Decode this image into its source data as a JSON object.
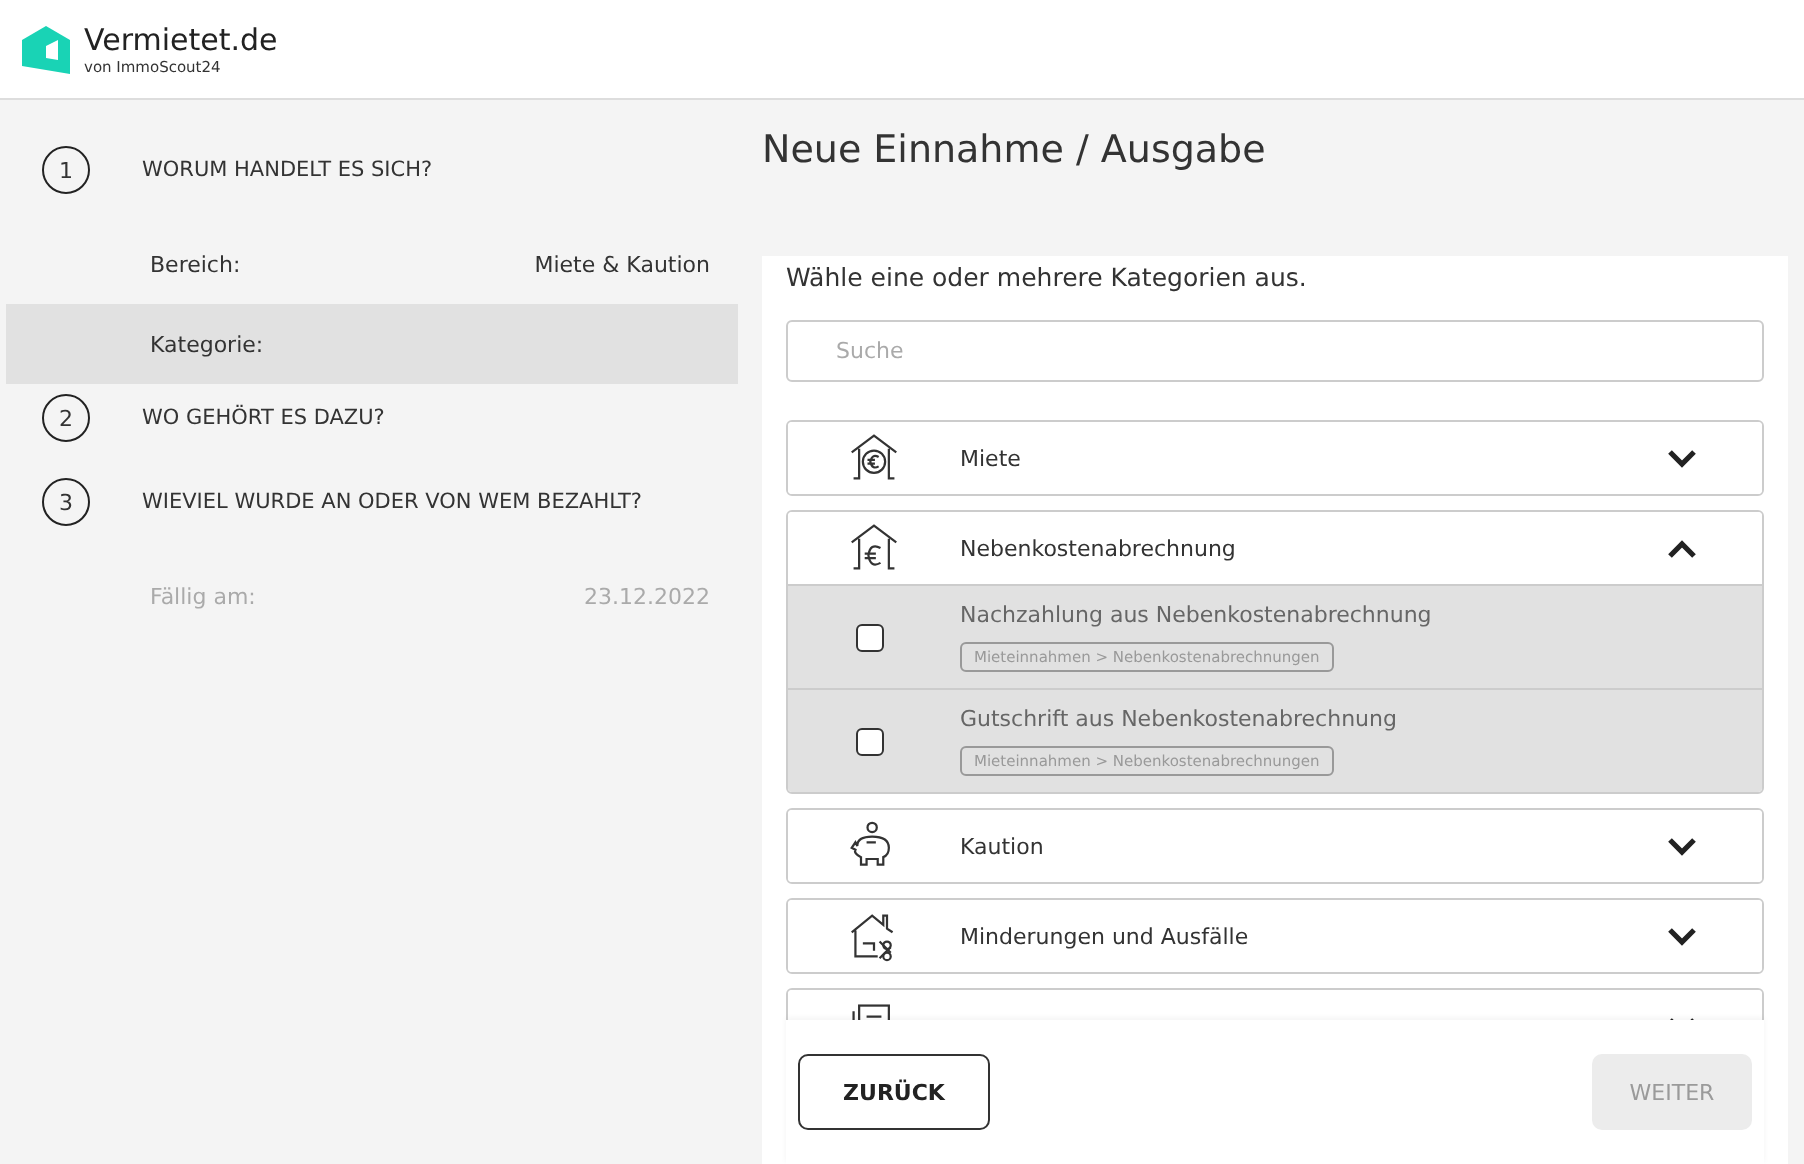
{
  "brand": {
    "name": "Vermietet.de",
    "tagline": "von ImmoScout24"
  },
  "steps": [
    {
      "number": "1",
      "title": "WORUM HANDELT ES SICH?",
      "fields": [
        {
          "label": "Bereich:",
          "value": "Miete & Kaution",
          "selected": false,
          "disabled": false
        },
        {
          "label": "Kategorie:",
          "selected": true,
          "disabled": false
        }
      ]
    },
    {
      "number": "2",
      "title": "WO GEHÖRT ES DAZU?"
    },
    {
      "number": "3",
      "title": "WIEVIEL WURDE AN ODER VON WEM BEZAHLT?",
      "fields": [
        {
          "label": "Fällig am:",
          "value": "23.12.2022",
          "selected": false,
          "disabled": true
        }
      ]
    }
  ],
  "page_title": "Neue Einnahme / Ausgabe",
  "instruction": "Wähle eine oder mehrere Kategorien aus.",
  "search": {
    "placeholder": "Suche"
  },
  "categories": [
    {
      "kind": "rent",
      "label": "Miete",
      "expanded": false
    },
    {
      "kind": "utility",
      "label": "Nebenkostenabrechnung",
      "expanded": true,
      "children": [
        {
          "label": "Nachzahlung aus Nebenkostenabrechnung",
          "tag": "Mieteinnahmen > Nebenkostenabrechnungen",
          "checked": false
        },
        {
          "label": "Gutschrift aus Nebenkostenabrechnung",
          "tag": "Mieteinnahmen > Nebenkostenabrechnungen",
          "checked": false
        }
      ]
    },
    {
      "kind": "deposit",
      "label": "Kaution",
      "expanded": false
    },
    {
      "kind": "reduction",
      "label": "Minderungen und Ausfälle",
      "expanded": false
    },
    {
      "kind": "other",
      "expanded": false
    }
  ],
  "buttons": {
    "back": {
      "label": "ZURÜCK"
    },
    "next": {
      "label": "WEITER",
      "disabled": true
    }
  }
}
